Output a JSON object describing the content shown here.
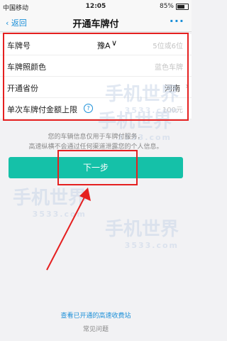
{
  "status_bar": {
    "carrier": "中国移动",
    "time": "12:05",
    "battery": "85%",
    "battery_level": 0.85
  },
  "nav": {
    "back": "返回",
    "title": "开通车牌付",
    "more": "···"
  },
  "form": {
    "plate": {
      "label": "车牌号",
      "province": "豫A",
      "placeholder": "5位或6位"
    },
    "color": {
      "label": "车牌照颜色",
      "placeholder": "蓝色车牌"
    },
    "province": {
      "label": "开通省份",
      "value": "河南"
    },
    "limit": {
      "label": "单次车牌付金额上限",
      "help": "?",
      "placeholder": "100元"
    }
  },
  "info": {
    "line1": "您的车辆信息仅用于车牌付服务，",
    "line2": "高速纵横不会通过任何渠道泄露您的个人信息。"
  },
  "next_button": "下一步",
  "links": {
    "toll_stations": "查看已开通的高速收费站",
    "faq": "常见问题"
  },
  "watermark": {
    "name": "手机世界",
    "site": "3533.com"
  },
  "colors": {
    "accent": "#1a8fd8",
    "button": "#15c1a8",
    "highlight": "#e52020"
  }
}
